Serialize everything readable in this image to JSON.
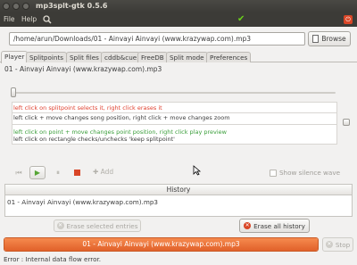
{
  "window": {
    "title": "mp3splt-gtk 0.5.6"
  },
  "menu": {
    "file": "File",
    "help": "Help",
    "search_icon": "search-icon",
    "check_icon": "check-icon",
    "quit_icon": "quit-icon"
  },
  "file": {
    "path": "/home/arun/Downloads/01 - Ainvayi Ainvayi (www.krazywap.com).mp3",
    "browse_label": "Browse"
  },
  "tabs": [
    "Player",
    "Splitpoints",
    "Split files",
    "cddb&cue",
    "FreeDB",
    "Split mode",
    "Preferences"
  ],
  "player": {
    "song_name": "01 - Ainvayi Ainvayi (www.krazywap.com).mp3",
    "position_fraction": 0.0,
    "hints": [
      "left click on splitpoint selects it, right click erases it",
      "left click + move changes song position, right click + move changes zoom",
      "left click on point + move changes point position, right click play preview",
      "left click on rectangle checks/unchecks 'keep splitpoint'"
    ],
    "add_label": "Add",
    "silence_label": "Show silence wave",
    "silence_checked": false
  },
  "history": {
    "title": "History",
    "items": [
      "01 - Ainvayi Ainvayi (www.krazywap.com).mp3"
    ],
    "erase_selected_label": "Erase selected entries",
    "erase_all_label": "Erase all history"
  },
  "split": {
    "progress_label": "01 - Ainvayi Ainvayi (www.krazywap.com).mp3",
    "progress_fraction": 1.0,
    "stop_label": "Stop"
  },
  "status": "Error : Internal data flow error.",
  "colors": {
    "accent": "#e1612a",
    "titlebar": "#3c3b37",
    "hint_red": "#e0402f",
    "hint_green": "#3a9e3a",
    "check_green": "#6bd11b"
  }
}
